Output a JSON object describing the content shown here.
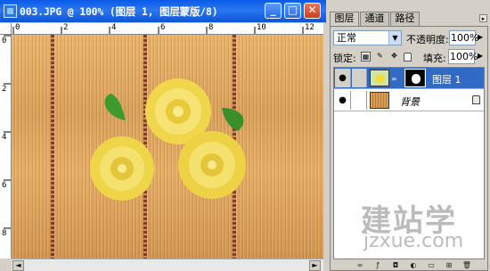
{
  "window": {
    "title": "003.JPG @ 100% (图层 1, 图层蒙版/8)",
    "minimize_glyph": "_",
    "maximize_glyph": "□",
    "close_glyph": "✕"
  },
  "rulers": {
    "top_ticks": [
      "0",
      "2",
      "4",
      "6",
      "8",
      "10",
      "12"
    ],
    "left_ticks": [
      "0",
      "2",
      "4",
      "6",
      "8"
    ]
  },
  "scrollbar": {
    "left_glyph": "◄",
    "right_glyph": "►"
  },
  "layers_palette": {
    "tabs": [
      "图层",
      "通道",
      "路径"
    ],
    "active_tab": "图层",
    "menu_glyph": "▸",
    "blend_mode": "正常",
    "opacity_label": "不透明度:",
    "opacity_value": "100%",
    "lock_label": "锁定:",
    "fill_label": "填充:",
    "fill_value": "100%",
    "layers": [
      {
        "name": "图层 1",
        "selected": true,
        "has_mask": true
      },
      {
        "name": "背景",
        "selected": false,
        "locked": true
      }
    ]
  },
  "icons": {
    "eye": "eye-icon",
    "lock": "lock-icon",
    "chain": "chain-icon"
  },
  "watermark": {
    "text_cn": "建站学",
    "text_en": "jzxue.com"
  }
}
